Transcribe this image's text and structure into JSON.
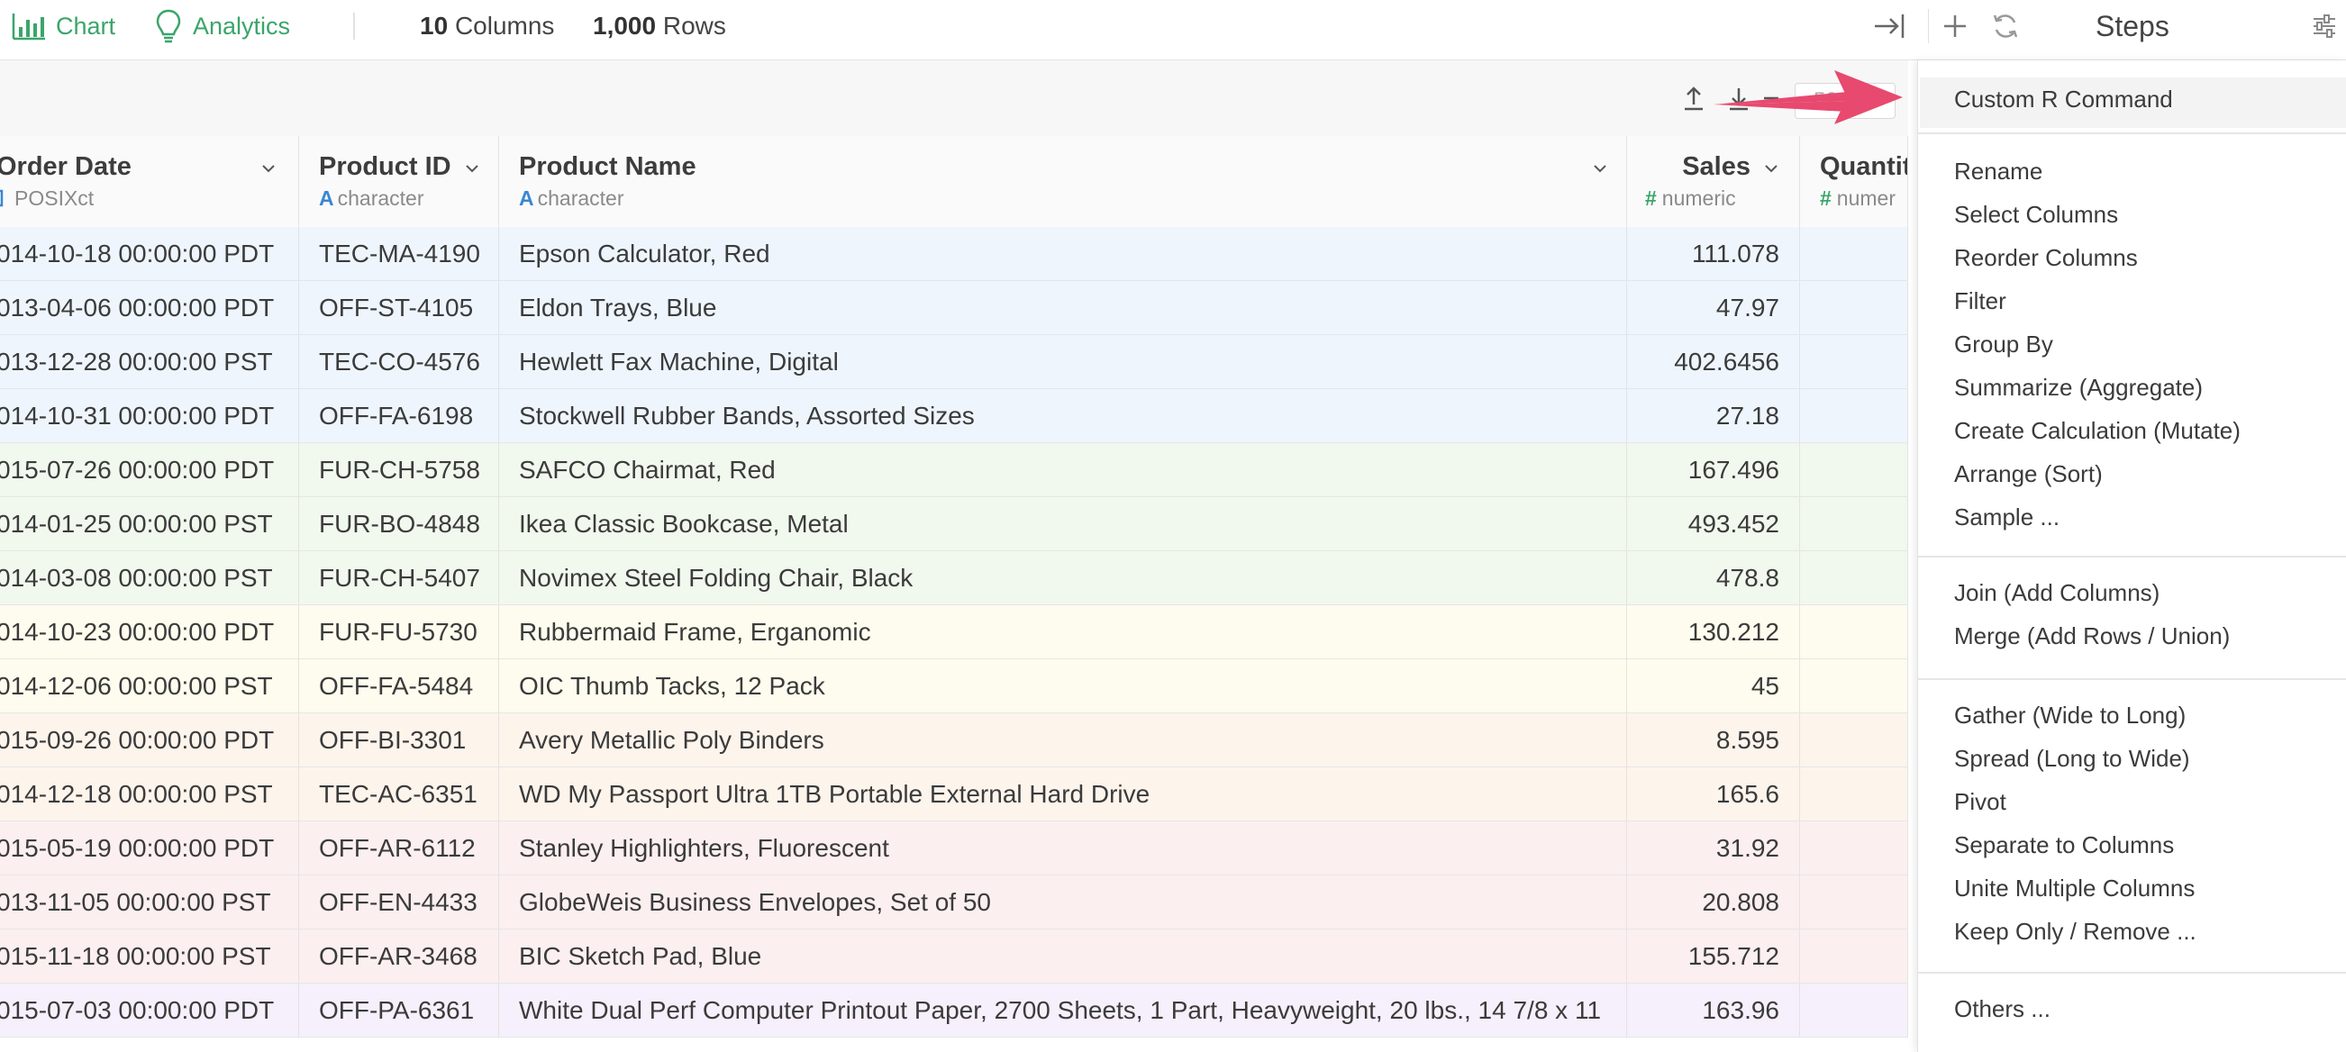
{
  "topbar": {
    "chart_label": "Chart",
    "analytics_label": "Analytics",
    "columns_count": "10",
    "columns_label": "Columns",
    "rows_count": "1,000",
    "rows_label": "Rows",
    "steps_title": "Steps"
  },
  "pager": {
    "value": "50"
  },
  "columns": [
    {
      "name": "Order Date",
      "type": "POSIXct",
      "type_icon": "clock-icon"
    },
    {
      "name": "Product ID",
      "type": "character",
      "type_icon": "A"
    },
    {
      "name": "Product Name",
      "type": "character",
      "type_icon": "A"
    },
    {
      "name": "Sales",
      "type": "numeric",
      "type_icon": "#"
    },
    {
      "name": "Quantit",
      "type": "numer",
      "type_icon": "#"
    }
  ],
  "rows": [
    {
      "date": "014-10-18 00:00:00 PDT",
      "pid": "TEC-MA-4190",
      "pname": "Epson Calculator, Red",
      "sales": "111.078"
    },
    {
      "date": "013-04-06 00:00:00 PDT",
      "pid": "OFF-ST-4105",
      "pname": "Eldon Trays, Blue",
      "sales": "47.97"
    },
    {
      "date": "013-12-28 00:00:00 PST",
      "pid": "TEC-CO-4576",
      "pname": "Hewlett Fax Machine, Digital",
      "sales": "402.6456"
    },
    {
      "date": "014-10-31 00:00:00 PDT",
      "pid": "OFF-FA-6198",
      "pname": "Stockwell Rubber Bands, Assorted Sizes",
      "sales": "27.18"
    },
    {
      "date": "015-07-26 00:00:00 PDT",
      "pid": "FUR-CH-5758",
      "pname": "SAFCO Chairmat, Red",
      "sales": "167.496"
    },
    {
      "date": "014-01-25 00:00:00 PST",
      "pid": "FUR-BO-4848",
      "pname": "Ikea Classic Bookcase, Metal",
      "sales": "493.452"
    },
    {
      "date": "014-03-08 00:00:00 PST",
      "pid": "FUR-CH-5407",
      "pname": "Novimex Steel Folding Chair, Black",
      "sales": "478.8"
    },
    {
      "date": "014-10-23 00:00:00 PDT",
      "pid": "FUR-FU-5730",
      "pname": "Rubbermaid Frame, Erganomic",
      "sales": "130.212"
    },
    {
      "date": "014-12-06 00:00:00 PST",
      "pid": "OFF-FA-5484",
      "pname": "OIC Thumb Tacks, 12 Pack",
      "sales": "45"
    },
    {
      "date": "015-09-26 00:00:00 PDT",
      "pid": "OFF-BI-3301",
      "pname": "Avery Metallic Poly Binders",
      "sales": "8.595"
    },
    {
      "date": "014-12-18 00:00:00 PST",
      "pid": "TEC-AC-6351",
      "pname": "WD My Passport Ultra 1TB Portable External Hard Drive",
      "sales": "165.6"
    },
    {
      "date": "015-05-19 00:00:00 PDT",
      "pid": "OFF-AR-6112",
      "pname": "Stanley Highlighters, Fluorescent",
      "sales": "31.92"
    },
    {
      "date": "013-11-05 00:00:00 PST",
      "pid": "OFF-EN-4433",
      "pname": "GlobeWeis Business Envelopes, Set of 50",
      "sales": "20.808"
    },
    {
      "date": "015-11-18 00:00:00 PST",
      "pid": "OFF-AR-3468",
      "pname": "BIC Sketch Pad, Blue",
      "sales": "155.712"
    },
    {
      "date": "015-07-03 00:00:00 PDT",
      "pid": "OFF-PA-6361",
      "pname": "White Dual Perf Computer Printout Paper, 2700 Sheets, 1 Part, Heavyweight, 20 lbs., 14 7/8 x 11",
      "sales": "163.96"
    }
  ],
  "row_colors": [
    "#eef5fd",
    "#eef5fd",
    "#eef5fd",
    "#eef5fd",
    "#f1f8ee",
    "#f1f8ee",
    "#f1f8ee",
    "#fdfcee",
    "#fdfcee",
    "#fdf4ec",
    "#fdf4ec",
    "#fcefef",
    "#fcefef",
    "#fcefef",
    "#f5f0fb"
  ],
  "menu": {
    "custom_r": "Custom R Command",
    "group1": [
      "Rename",
      "Select Columns",
      "Reorder Columns",
      "Filter",
      "Group By",
      "Summarize (Aggregate)",
      "Create Calculation (Mutate)",
      "Arrange (Sort)",
      "Sample ..."
    ],
    "group2": [
      "Join (Add Columns)",
      "Merge (Add Rows / Union)"
    ],
    "group3": [
      "Gather (Wide to Long)",
      "Spread (Long to Wide)",
      "Pivot",
      "Separate to Columns",
      "Unite Multiple Columns",
      "Keep Only / Remove ..."
    ],
    "others": "Others ..."
  },
  "colors": {
    "accent_green": "#3aa56a",
    "type_blue": "#3a86d4",
    "arrow_pink": "#e8496f"
  }
}
